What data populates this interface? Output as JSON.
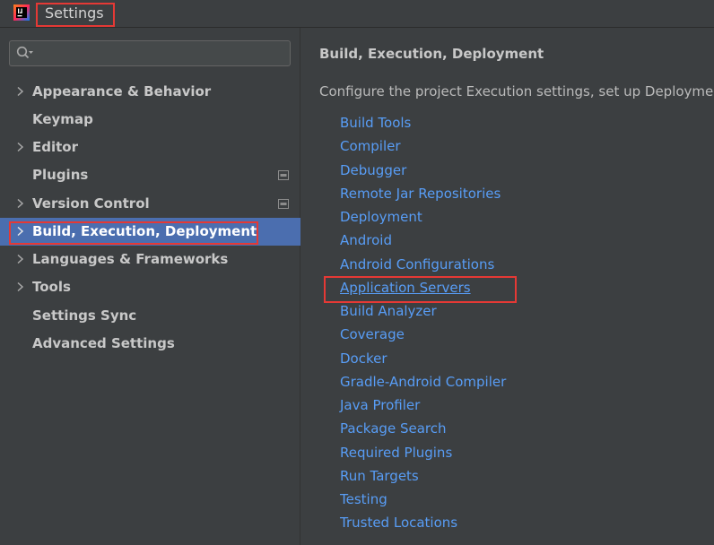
{
  "window": {
    "title": "Settings"
  },
  "search": {
    "value": "",
    "placeholder": ""
  },
  "sidebar": {
    "items": [
      {
        "label": "Appearance & Behavior",
        "expandable": true
      },
      {
        "label": "Keymap",
        "expandable": false
      },
      {
        "label": "Editor",
        "expandable": true
      },
      {
        "label": "Plugins",
        "expandable": false
      },
      {
        "label": "Version Control",
        "expandable": true
      },
      {
        "label": "Build, Execution, Deployment",
        "expandable": true,
        "selected": true
      },
      {
        "label": "Languages & Frameworks",
        "expandable": true
      },
      {
        "label": "Tools",
        "expandable": true
      },
      {
        "label": "Settings Sync",
        "expandable": false
      },
      {
        "label": "Advanced Settings",
        "expandable": false
      }
    ]
  },
  "main": {
    "title": "Build, Execution, Deployment",
    "description": "Configure the project Execution settings, set up Deployment",
    "links": [
      "Build Tools",
      "Compiler",
      "Debugger",
      "Remote Jar Repositories",
      "Deployment",
      "Android",
      "Android Configurations",
      "Application Servers",
      "Build Analyzer",
      "Coverage",
      "Docker",
      "Gradle-Android Compiler",
      "Java Profiler",
      "Package Search",
      "Required Plugins",
      "Run Targets",
      "Testing",
      "Trusted Locations"
    ]
  },
  "colors": {
    "background": "#3c3f41",
    "selection": "#4b6eaf",
    "link": "#589df6",
    "highlight_box": "#e53935"
  },
  "icons": {
    "app": "intellij-idea-icon",
    "search": "search-icon",
    "expand": "chevron-right-icon",
    "scope": "project-scope-icon"
  }
}
